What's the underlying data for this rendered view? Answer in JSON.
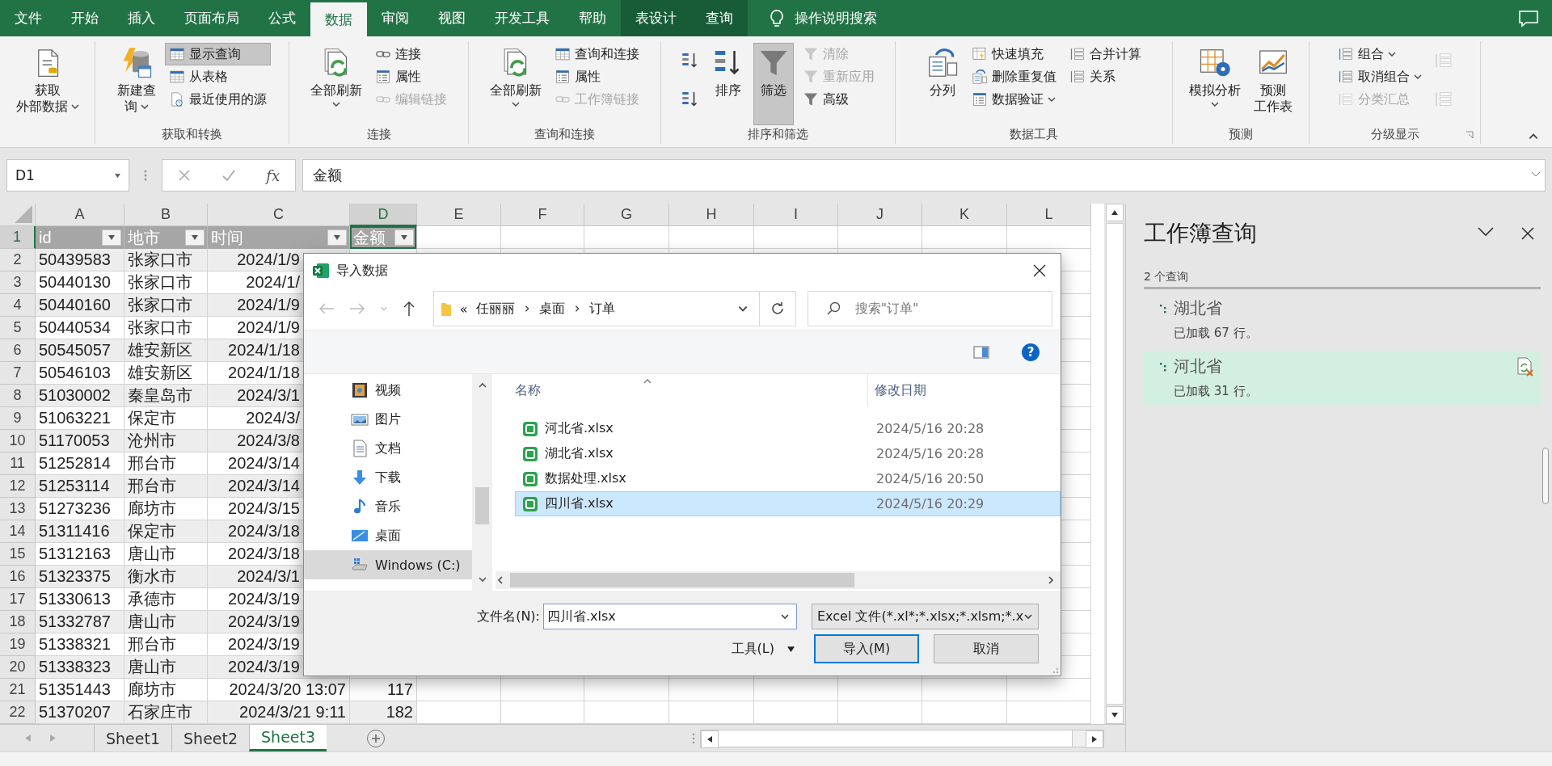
{
  "tabs": [
    {
      "label": "文件",
      "selected": false,
      "kind": "normal"
    },
    {
      "label": "开始",
      "selected": false,
      "kind": "normal"
    },
    {
      "label": "插入",
      "selected": false,
      "kind": "normal"
    },
    {
      "label": "页面布局",
      "selected": false,
      "kind": "normal"
    },
    {
      "label": "公式",
      "selected": false,
      "kind": "normal"
    },
    {
      "label": "数据",
      "selected": true,
      "kind": "normal"
    },
    {
      "label": "审阅",
      "selected": false,
      "kind": "normal"
    },
    {
      "label": "视图",
      "selected": false,
      "kind": "normal"
    },
    {
      "label": "开发工具",
      "selected": false,
      "kind": "normal"
    },
    {
      "label": "帮助",
      "selected": false,
      "kind": "normal"
    },
    {
      "label": "表设计",
      "selected": false,
      "kind": "contextual"
    },
    {
      "label": "查询",
      "selected": false,
      "kind": "contextual"
    }
  ],
  "tell_me": "操作说明搜索",
  "ribbon": {
    "groups": [
      {
        "columns": [
          [
            {
              "kind": "large",
              "label_lines": [
                "获取",
                "外部数据"
              ],
              "dropdown": true,
              "pressed": false,
              "disabled": false
            }
          ]
        ]
      },
      {
        "label": "获取和转换",
        "columns": [
          [
            {
              "kind": "large",
              "label_lines": [
                "新建查",
                "询"
              ],
              "dropdown": true,
              "pressed": false,
              "disabled": false
            }
          ],
          [
            {
              "kind": "small",
              "label": "显示查询",
              "pressed": true,
              "disabled": false
            },
            {
              "kind": "small",
              "label": "从表格",
              "pressed": false,
              "disabled": false
            },
            {
              "kind": "small",
              "label": "最近使用的源",
              "pressed": false,
              "disabled": false
            }
          ]
        ]
      },
      {
        "label": "连接",
        "columns": [
          [
            {
              "kind": "large",
              "label": "全部刷新",
              "dropdown": true,
              "pressed": false,
              "disabled": false
            }
          ],
          [
            {
              "kind": "small",
              "label": "连接",
              "pressed": false,
              "disabled": false
            },
            {
              "kind": "small",
              "label": "属性",
              "pressed": false,
              "disabled": false
            },
            {
              "kind": "small",
              "label": "编辑链接",
              "pressed": false,
              "disabled": true
            }
          ]
        ]
      },
      {
        "label": "查询和连接",
        "columns": [
          [
            {
              "kind": "large",
              "label": "全部刷新",
              "dropdown": true,
              "pressed": false,
              "disabled": false
            }
          ],
          [
            {
              "kind": "small",
              "label": "查询和连接",
              "pressed": false,
              "disabled": false
            },
            {
              "kind": "small",
              "label": "属性",
              "pressed": false,
              "disabled": false
            },
            {
              "kind": "small",
              "label": "工作簿链接",
              "pressed": false,
              "disabled": true
            }
          ]
        ]
      },
      {
        "label": "排序和筛选",
        "columns": [
          [
            {
              "kind": "icon",
              "pressed": false,
              "disabled": false
            },
            {
              "kind": "icon",
              "pressed": false,
              "disabled": false
            }
          ],
          [
            {
              "kind": "large",
              "label": "排序",
              "pressed": false,
              "disabled": false
            }
          ],
          [
            {
              "kind": "large",
              "label": "筛选",
              "pressed": true,
              "disabled": false
            }
          ],
          [
            {
              "kind": "small",
              "label": "清除",
              "pressed": false,
              "disabled": true
            },
            {
              "kind": "small",
              "label": "重新应用",
              "pressed": false,
              "disabled": true
            },
            {
              "kind": "small",
              "label": "高级",
              "pressed": false,
              "disabled": false
            }
          ]
        ]
      },
      {
        "label": "数据工具",
        "columns": [
          [
            {
              "kind": "large",
              "label": "分列",
              "pressed": false,
              "disabled": false
            }
          ],
          [
            {
              "kind": "small",
              "label": "快速填充",
              "pressed": false,
              "disabled": false
            },
            {
              "kind": "small",
              "label": "删除重复值",
              "pressed": false,
              "disabled": false
            },
            {
              "kind": "small",
              "label": "数据验证",
              "dropdown": true,
              "pressed": false,
              "disabled": false
            }
          ],
          [
            {
              "kind": "small",
              "label": "合并计算",
              "pressed": false,
              "disabled": false
            },
            {
              "kind": "small",
              "label": "关系",
              "pressed": false,
              "disabled": false
            }
          ]
        ]
      },
      {
        "label": "预测",
        "columns": [
          [
            {
              "kind": "large",
              "label": "模拟分析",
              "dropdown": true,
              "pressed": false,
              "disabled": false
            }
          ],
          [
            {
              "kind": "large",
              "label_lines": [
                "预测",
                "工作表"
              ],
              "pressed": false,
              "disabled": false
            }
          ]
        ]
      },
      {
        "label": "分级显示",
        "columns": [
          [
            {
              "kind": "small",
              "label": "组合",
              "dropdown": true,
              "pressed": false,
              "disabled": false
            },
            {
              "kind": "small",
              "label": "取消组合",
              "dropdown": true,
              "pressed": false,
              "disabled": false
            },
            {
              "kind": "small",
              "label": "分类汇总",
              "pressed": false,
              "disabled": true
            }
          ],
          [
            {
              "kind": "icon",
              "pressed": false,
              "disabled": true
            },
            {
              "kind": "icon",
              "pressed": false,
              "disabled": true
            }
          ]
        ]
      }
    ]
  },
  "formula_bar": {
    "name_box": "D1",
    "fx": "fx",
    "value": "金额"
  },
  "sheet": {
    "columns": [
      {
        "label": "A",
        "selected": false
      },
      {
        "label": "B",
        "selected": false
      },
      {
        "label": "C",
        "selected": false
      },
      {
        "label": "D",
        "selected": true
      },
      {
        "label": "E",
        "selected": false
      },
      {
        "label": "F",
        "selected": false
      },
      {
        "label": "G",
        "selected": false
      },
      {
        "label": "H",
        "selected": false
      },
      {
        "label": "I",
        "selected": false
      },
      {
        "label": "J",
        "selected": false
      },
      {
        "label": "K",
        "selected": false
      },
      {
        "label": "L",
        "selected": false
      }
    ],
    "header_row": {
      "num": "1",
      "selected": true,
      "cells": [
        "id",
        "地市",
        "时间",
        "金额"
      ]
    },
    "rows": [
      {
        "num": "2",
        "selected": false,
        "cells": [
          "50439583",
          "张家口市",
          "2024/1/9"
        ]
      },
      {
        "num": "3",
        "selected": false,
        "cells": [
          "50440130",
          "张家口市",
          "2024/1/"
        ]
      },
      {
        "num": "4",
        "selected": false,
        "cells": [
          "50440160",
          "张家口市",
          "2024/1/9"
        ]
      },
      {
        "num": "5",
        "selected": false,
        "cells": [
          "50440534",
          "张家口市",
          "2024/1/9"
        ]
      },
      {
        "num": "6",
        "selected": false,
        "cells": [
          "50545057",
          "雄安新区",
          "2024/1/18"
        ]
      },
      {
        "num": "7",
        "selected": false,
        "cells": [
          "50546103",
          "雄安新区",
          "2024/1/18"
        ]
      },
      {
        "num": "8",
        "selected": false,
        "cells": [
          "51030002",
          "秦皇岛市",
          "2024/3/1"
        ]
      },
      {
        "num": "9",
        "selected": false,
        "cells": [
          "51063221",
          "保定市",
          "2024/3/"
        ]
      },
      {
        "num": "10",
        "selected": false,
        "cells": [
          "51170053",
          "沧州市",
          "2024/3/8"
        ]
      },
      {
        "num": "11",
        "selected": false,
        "cells": [
          "51252814",
          "邢台市",
          "2024/3/14"
        ]
      },
      {
        "num": "12",
        "selected": false,
        "cells": [
          "51253114",
          "邢台市",
          "2024/3/14"
        ]
      },
      {
        "num": "13",
        "selected": false,
        "cells": [
          "51273236",
          "廊坊市",
          "2024/3/15"
        ]
      },
      {
        "num": "14",
        "selected": false,
        "cells": [
          "51311416",
          "保定市",
          "2024/3/18"
        ]
      },
      {
        "num": "15",
        "selected": false,
        "cells": [
          "51312163",
          "唐山市",
          "2024/3/18"
        ]
      },
      {
        "num": "16",
        "selected": false,
        "cells": [
          "51323375",
          "衡水市",
          "2024/3/1"
        ]
      },
      {
        "num": "17",
        "selected": false,
        "cells": [
          "51330613",
          "承德市",
          "2024/3/19"
        ]
      },
      {
        "num": "18",
        "selected": false,
        "cells": [
          "51332787",
          "唐山市",
          "2024/3/19"
        ]
      },
      {
        "num": "19",
        "selected": false,
        "cells": [
          "51338321",
          "邢台市",
          "2024/3/19"
        ]
      },
      {
        "num": "20",
        "selected": false,
        "cells": [
          "51338323",
          "唐山市",
          "2024/3/19"
        ]
      },
      {
        "num": "21",
        "selected": false,
        "cells": [
          "51351443",
          "廊坊市",
          "2024/3/20 13:07",
          "117"
        ]
      },
      {
        "num": "22",
        "selected": false,
        "cells": [
          "51370207",
          "石家庄市",
          "2024/3/21 9:11",
          "182"
        ]
      }
    ]
  },
  "sheet_tabs": [
    {
      "label": "Sheet1",
      "selected": false
    },
    {
      "label": "Sheet2",
      "selected": false
    },
    {
      "label": "Sheet3",
      "selected": true
    }
  ],
  "panel": {
    "title": "工作簿查询",
    "count": "2 个查询",
    "queries": [
      {
        "name": "湖北省",
        "status": "已加载 67 行。",
        "selected": false
      },
      {
        "name": "河北省",
        "status": "已加载 31 行。",
        "selected": true
      }
    ]
  },
  "dialog": {
    "title": "导入数据",
    "overflow": "«",
    "path": [
      "任丽丽",
      "桌面",
      "订单"
    ],
    "search_placeholder": "搜索\"订单\"",
    "help": "?",
    "nav": [
      {
        "label": "视频",
        "selected": false
      },
      {
        "label": "图片",
        "selected": false
      },
      {
        "label": "文档",
        "selected": false
      },
      {
        "label": "下载",
        "selected": false
      },
      {
        "label": "音乐",
        "selected": false
      },
      {
        "label": "桌面",
        "selected": false
      },
      {
        "label": "Windows (C:)",
        "selected": true
      }
    ],
    "columns": [
      "名称",
      "修改日期"
    ],
    "files": [
      {
        "name": "河北省.xlsx",
        "date": "2024/5/16 20:28",
        "selected": false
      },
      {
        "name": "湖北省.xlsx",
        "date": "2024/5/16 20:28",
        "selected": false
      },
      {
        "name": "数据处理.xlsx",
        "date": "2024/5/16 20:50",
        "selected": false
      },
      {
        "name": "四川省.xlsx",
        "date": "2024/5/16 20:29",
        "selected": true
      }
    ],
    "filename_label": "文件名(N):",
    "filename": "四川省.xlsx",
    "filter": "Excel 文件(*.xl*;*.xlsx;*.xlsm;*.x",
    "tools": "工具(L)",
    "ok": "导入(M)",
    "cancel": "取消"
  }
}
